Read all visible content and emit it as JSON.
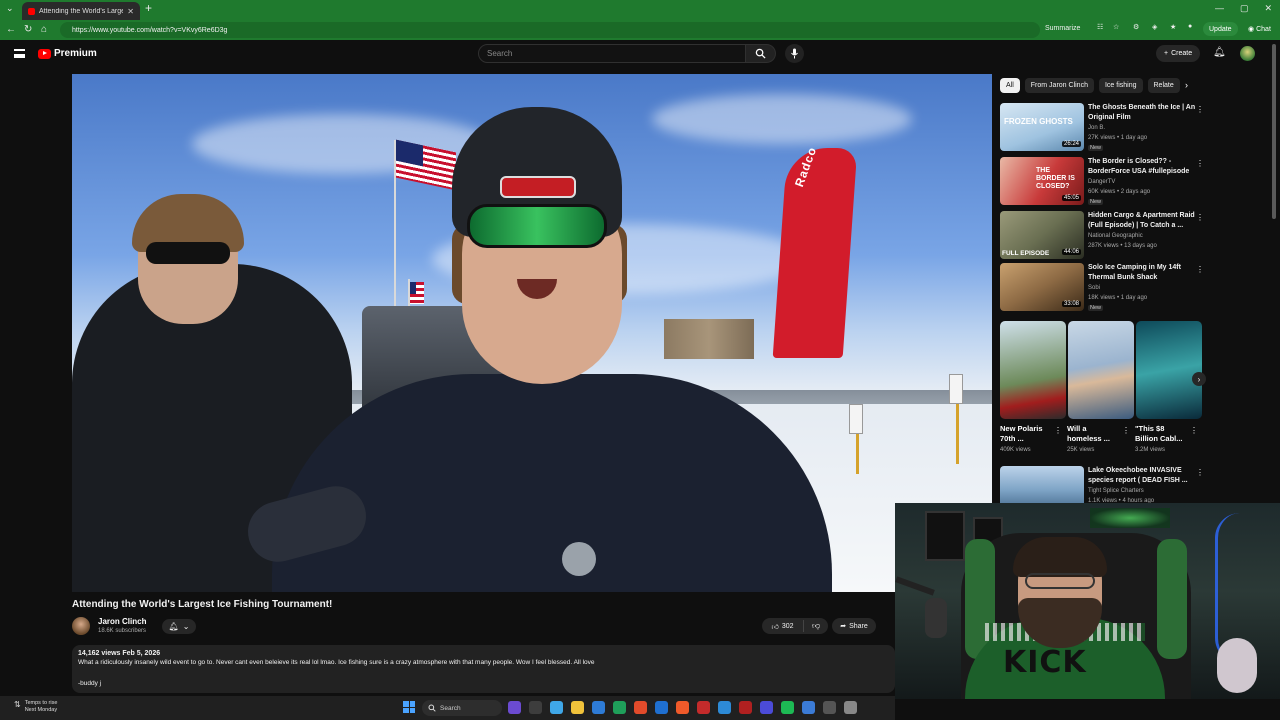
{
  "browser": {
    "tab_title": "Attending the World's Largest",
    "url": "https://www.youtube.com/watch?v=VKvy6Re6D3g",
    "summarize_label": "Summarize",
    "update_label": "Update",
    "chat_label": "Chat"
  },
  "header": {
    "logo_label": "Premium",
    "search_placeholder": "Search",
    "create_label": "Create"
  },
  "video": {
    "banner_text": "Radco",
    "title": "Attending the World's Largest Ice Fishing Tournament!",
    "channel": "Jaron Clinch",
    "subscribers": "18.6K subscribers",
    "likes": "302",
    "share_label": "Share",
    "meta": "14,162 views  Feb 5, 2026",
    "description": "What a ridiculously insanely wild event to go to. Never cant even beleieve its real lol lmao. Ice fishing sure is a crazy atmosphere with that many people. Wow I feel blessed. All love",
    "signature": "-buddy j"
  },
  "chips": [
    "All",
    "From Jaron Clinch",
    "Ice fishing",
    "Relate"
  ],
  "recommendations": [
    {
      "title": "The Ghosts Beneath the Ice | An Original Film",
      "channel": "Jon B.",
      "views": "27K views • 1 day ago",
      "badge": "New",
      "duration": "26:24",
      "thumb_text": "FROZEN GHOSTS",
      "thumb_color": "#9fc3e0"
    },
    {
      "title": "The Border is Closed?? - BorderForce USA #fullepisode",
      "channel": "DangerTV",
      "views": "60K views • 2 days ago",
      "badge": "New",
      "duration": "45:05",
      "thumb_text": "THE BORDER IS CLOSED?",
      "thumb_color": "#c83a3a"
    },
    {
      "title": "Hidden Cargo & Apartment Raid (Full Episode) | To Catch a ...",
      "channel": "National Geographic",
      "views": "287K views • 13 days ago",
      "badge": "",
      "duration": "44:06",
      "thumb_text": "FULL EPISODE",
      "thumb_color": "#6a6f52"
    },
    {
      "title": "Solo Ice Camping in My 14ft Thermal Bunk Shack",
      "channel": "Sobi",
      "views": "18K views • 1 day ago",
      "badge": "New",
      "duration": "33:08",
      "thumb_text": "",
      "thumb_color": "#8d6a44"
    },
    {
      "title": "Lake Okeechobee INVASIVE species report ( DEAD FISH ...",
      "channel": "Tight Splice Charters",
      "views": "1.1K views • 4 hours ago",
      "badge": "",
      "duration": "",
      "thumb_text": "",
      "thumb_color": "#7ea4c6"
    }
  ],
  "shorts": [
    {
      "title": "New Polaris 70th ...",
      "views": "409K views",
      "color": "#6d8a5a"
    },
    {
      "title": "Will a homeless ...",
      "views": "25K views",
      "color": "#9bb4cf"
    },
    {
      "title": "\"This $8 Billion Cabl...",
      "views": "3.2M views",
      "color": "#3aa3a6"
    }
  ],
  "taskbar": {
    "weather_line1": "Temps to rise",
    "weather_line2": "Next Monday",
    "search_label": "Search",
    "icon_colors": [
      "#6b4bd1",
      "#3d3d3d",
      "#3fa7e8",
      "#f0c23b",
      "#2e7bd6",
      "#1f9f5a",
      "#e24b2b",
      "#1f6fd0",
      "#f05a2a",
      "#c42b2b",
      "#2d8ad6",
      "#b02020",
      "#4b4bd8",
      "#1db954",
      "#3b7bd6",
      "#555555",
      "#888888"
    ]
  },
  "webcam": {
    "shirt_text": "KICK"
  }
}
